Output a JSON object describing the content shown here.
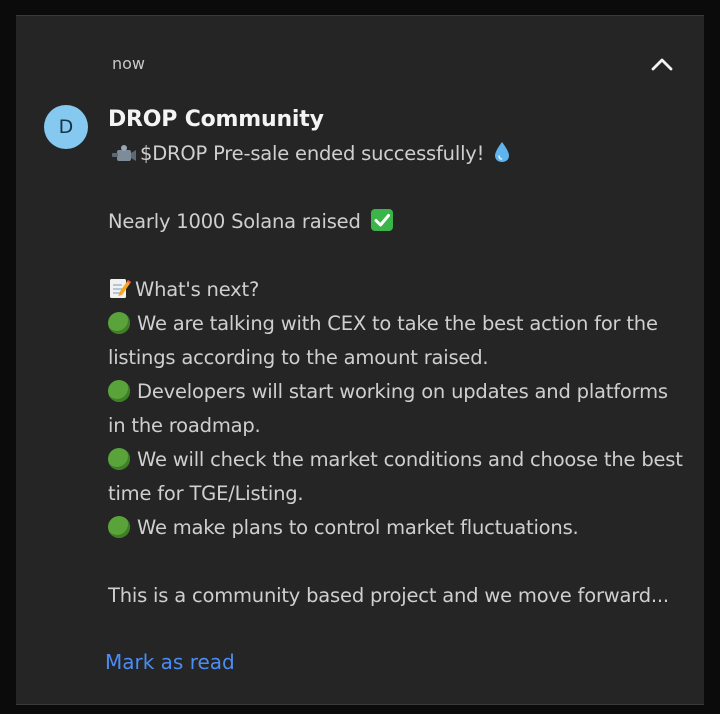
{
  "notification": {
    "time": "now",
    "avatar_letter": "D",
    "sender": "DROP Community",
    "line_presale": "$DROP Pre-sale ended successfully!",
    "line_raised": "Nearly 1000 Solana raised",
    "line_next": "What's next?",
    "bullet_1": "We are talking with CEX to take the best action for the listings according to the amount raised.",
    "bullet_2": "Developers will start working on updates and platforms in the roadmap.",
    "bullet_3": "We will check the market conditions and choose the best time for TGE/Listing.",
    "bullet_4": "We make plans to control market fluctuations.",
    "line_community": "This is a community based project and we move forward...",
    "action_label": "Mark as read"
  },
  "icons": {
    "collapse": "chevron-up-icon",
    "camera": "video-camera-icon",
    "droplet": "droplet-icon",
    "check": "check-mark-button-icon",
    "memo": "memo-icon",
    "bullet": "green-circle-icon"
  },
  "colors": {
    "background": "#0b0b0b",
    "card": "#252526",
    "avatar": "#86c9f0",
    "link": "#4a8df5",
    "bullet": "#5aa33a",
    "check": "#3bb54a"
  }
}
